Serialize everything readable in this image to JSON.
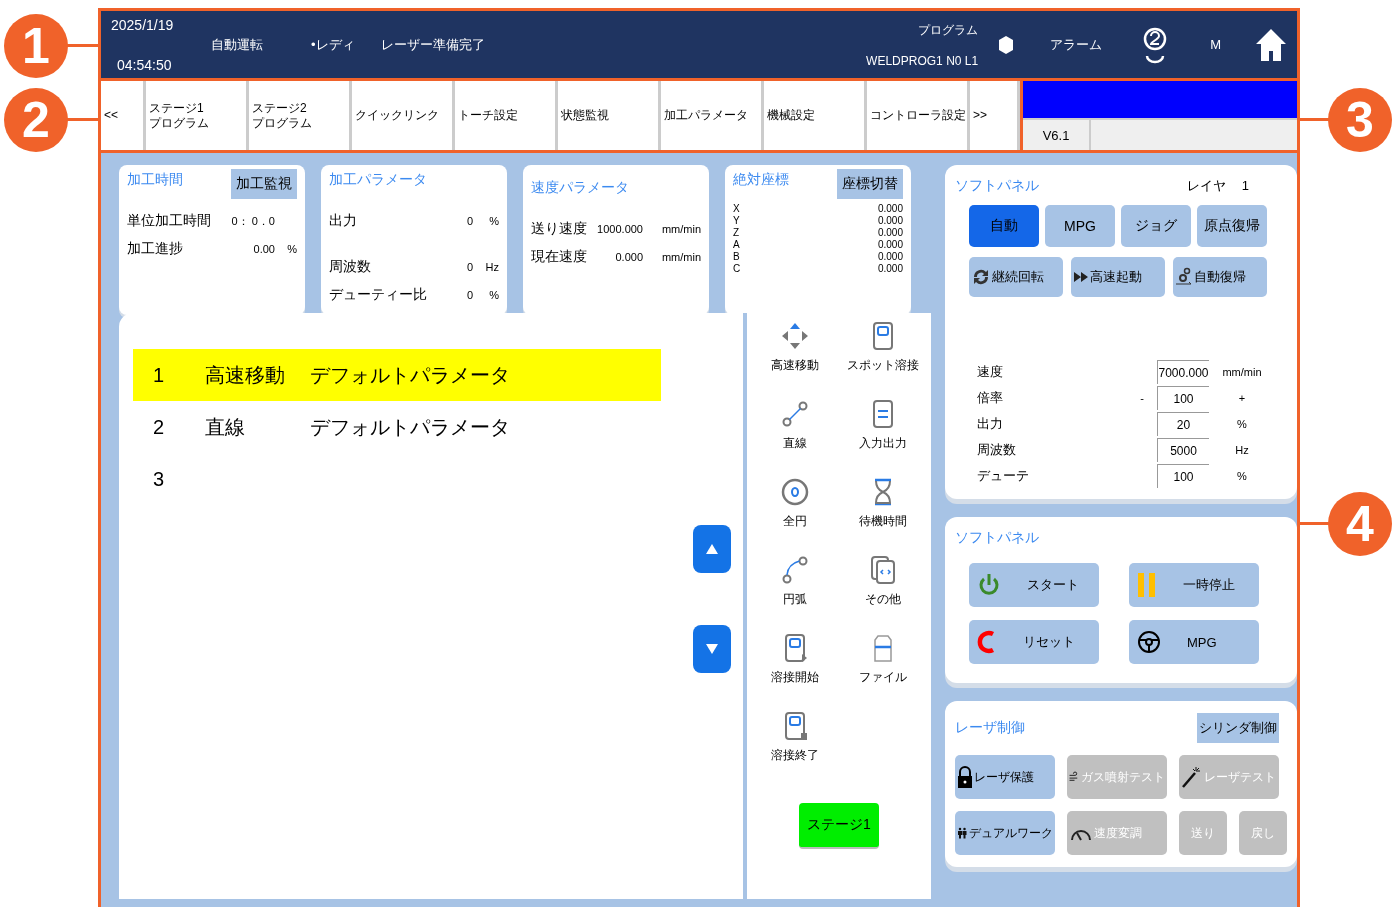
{
  "callouts": [
    "1",
    "2",
    "3",
    "4"
  ],
  "header": {
    "date": "2025/1/19",
    "time": "04:54:50",
    "mode": "自動運転",
    "status": "•レディ",
    "laser": "レーザー準備完了",
    "program_label": "プログラム",
    "program_name": "WELDPROG1 N0 L1",
    "alarm": "アラーム",
    "m": "M"
  },
  "tabs": [
    {
      "lines": [
        "<<"
      ],
      "selected": false
    },
    {
      "lines": [
        "ステージ1",
        "プログラム"
      ],
      "selected": false
    },
    {
      "lines": [
        "ステージ2",
        "プログラム"
      ],
      "selected": false
    },
    {
      "lines": [
        "クイックリンク"
      ],
      "selected": false
    },
    {
      "lines": [
        "トーチ設定"
      ],
      "selected": false
    },
    {
      "lines": [
        "状態監視"
      ],
      "selected": false
    },
    {
      "lines": [
        "加工パラメータ"
      ],
      "selected": false
    },
    {
      "lines": [
        "機械設定"
      ],
      "selected": false
    },
    {
      "lines": [
        "コントローラ設定"
      ],
      "selected": false
    },
    {
      "lines": [
        ">>"
      ],
      "selected": false
    }
  ],
  "version": "V6.1",
  "cards": [
    {
      "kind": "time",
      "title": "加工時間",
      "button": "加工監視",
      "rows": [
        {
          "label": "単位加工時間",
          "value": "0： 0．0"
        },
        {
          "label": "加工進捗",
          "value": "0.00",
          "unit": "%"
        }
      ]
    },
    {
      "kind": "params",
      "title": "加工パラメータ",
      "rows": [
        {
          "label": "出力",
          "value": "0",
          "unit": "%"
        },
        {
          "label": "周波数",
          "value": "0",
          "unit": "Hz"
        },
        {
          "label": "デューティー比",
          "value": "0",
          "unit": "%"
        }
      ]
    },
    {
      "kind": "speed",
      "title": "速度パラメータ",
      "rows": [
        {
          "label": "送り速度",
          "value": "1000.000",
          "unit": "mm/min"
        },
        {
          "label": "現在速度",
          "value": "0.000",
          "unit": "mm/min"
        }
      ]
    },
    {
      "kind": "coords",
      "title": "絶対座標",
      "button": "座標切替",
      "rows": [
        {
          "label": "X",
          "value": "0.000"
        },
        {
          "label": "Y",
          "value": "0.000"
        },
        {
          "label": "Z",
          "value": "0.000"
        },
        {
          "label": "A",
          "value": "0.000"
        },
        {
          "label": "B",
          "value": "0.000"
        },
        {
          "label": "C",
          "value": "0.000"
        }
      ]
    }
  ],
  "program": [
    {
      "number": "1",
      "command": "高速移動",
      "parameter": "デフォルトパラメータ",
      "selected": true
    },
    {
      "number": "2",
      "command": "直線",
      "parameter": "デフォルトパラメータ",
      "selected": false
    },
    {
      "number": "3",
      "selected": false
    }
  ],
  "palette": [
    {
      "kind": "rapid",
      "label": "高速移動"
    },
    {
      "kind": "spot",
      "label": "スポット溶接"
    },
    {
      "kind": "line",
      "label": "直線"
    },
    {
      "kind": "io",
      "label": "入力出力"
    },
    {
      "kind": "circle",
      "label": "全円"
    },
    {
      "kind": "wait",
      "label": "待機時間"
    },
    {
      "kind": "arc",
      "label": "円弧"
    },
    {
      "kind": "other",
      "label": "その他"
    },
    {
      "kind": "weld_start",
      "label": "溶接開始"
    },
    {
      "kind": "file",
      "label": "ファイル"
    },
    {
      "kind": "weld_end",
      "label": "溶接終了"
    }
  ],
  "stage_button": "ステージ1",
  "soft_panel": {
    "title": "ソフトパネル",
    "layer_label": "レイヤ",
    "layer": "1",
    "modes": [
      {
        "label": "自動",
        "selected": true
      },
      {
        "label": "MPG",
        "selected": false
      },
      {
        "label": "ジョグ",
        "selected": false
      },
      {
        "label": "原点復帰",
        "selected": false
      }
    ],
    "functions": [
      {
        "label": "継続回転"
      },
      {
        "label": "高速起動"
      },
      {
        "label": "自動復帰"
      }
    ],
    "params": [
      {
        "label": "速度",
        "value": "7000.000",
        "unit": "mm/min"
      },
      {
        "label": "倍率",
        "minus": "-",
        "value": "100",
        "plus": "+"
      },
      {
        "label": "出力",
        "value": "20",
        "unit": "%"
      },
      {
        "label": "周波数",
        "value": "5000",
        "unit": "Hz"
      },
      {
        "label": "デューテ",
        "value": "100",
        "unit": "%"
      }
    ]
  },
  "soft_panel_2": {
    "title": "ソフトパネル",
    "buttons": [
      {
        "label": "スタート"
      },
      {
        "label": "一時停止"
      },
      {
        "label": "リセット"
      },
      {
        "label": "MPG"
      }
    ]
  },
  "laser": {
    "title": "レーザ制御",
    "cylinder_button": "シリンダ制御",
    "buttons": [
      {
        "label": "レーザ保護",
        "disabled": false
      },
      {
        "label": "ガス噴射テスト",
        "disabled": true
      },
      {
        "label": "レーザテスト",
        "disabled": true
      },
      {
        "label": "デュアルワーク",
        "disabled": false
      },
      {
        "label": "速度変調",
        "disabled": true
      },
      {
        "label": "送り",
        "disabled": true
      },
      {
        "label": "戻し",
        "disabled": true
      }
    ]
  }
}
